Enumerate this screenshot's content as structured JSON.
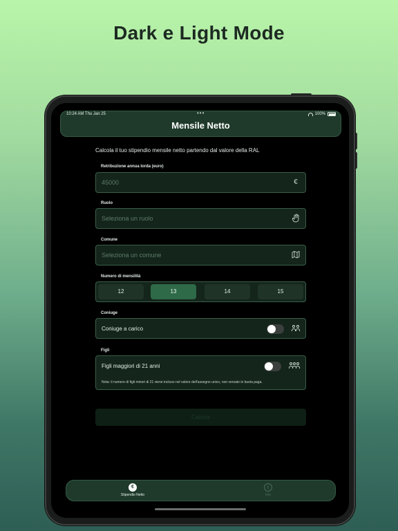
{
  "headline": "Dark e Light Mode",
  "status": {
    "time": "10:24 AM   Thu Jan 25",
    "dots": "•••",
    "battery": "100%"
  },
  "nav": {
    "title": "Mensile Netto"
  },
  "intro": "Calcola il tuo stipendio mensile netto partendo dal valore della RAL",
  "ral": {
    "label": "Retribuzione annua lorda (euro)",
    "placeholder": "45000",
    "icon": "euro-icon",
    "symbol": "€"
  },
  "ruolo": {
    "label": "Ruolo",
    "placeholder": "Seleziona un ruolo",
    "icon": "hand-icon"
  },
  "comune": {
    "label": "Comune",
    "placeholder": "Seleziona un comune",
    "icon": "map-icon"
  },
  "mensilita": {
    "label": "Numero di mensilità",
    "options": [
      "12",
      "13",
      "14",
      "15"
    ],
    "selected": "13"
  },
  "coniuge": {
    "label": "Coniuge",
    "toggle_label": "Coniuge a carico",
    "value": false,
    "icon": "two-people-icon"
  },
  "figli": {
    "label": "Figli",
    "toggle_label": "Figli maggiori di 21 anni",
    "value": false,
    "icon": "three-people-icon",
    "note": "Nota: il numero di figli minori di 21 viene incluso nel valore dell'assegno unico, non versato in busta paga."
  },
  "calculate": {
    "label": "Calcola"
  },
  "tabs": [
    {
      "label": "Stipendio Netto",
      "icon": "euro-circle-icon",
      "glyph": "€",
      "active": true
    },
    {
      "label": "Info",
      "icon": "info-circle-icon",
      "glyph": "i",
      "active": false
    }
  ],
  "colors": {
    "accent": "#2e6a48",
    "bar": "#1f3a2b",
    "field": "#14251b"
  }
}
